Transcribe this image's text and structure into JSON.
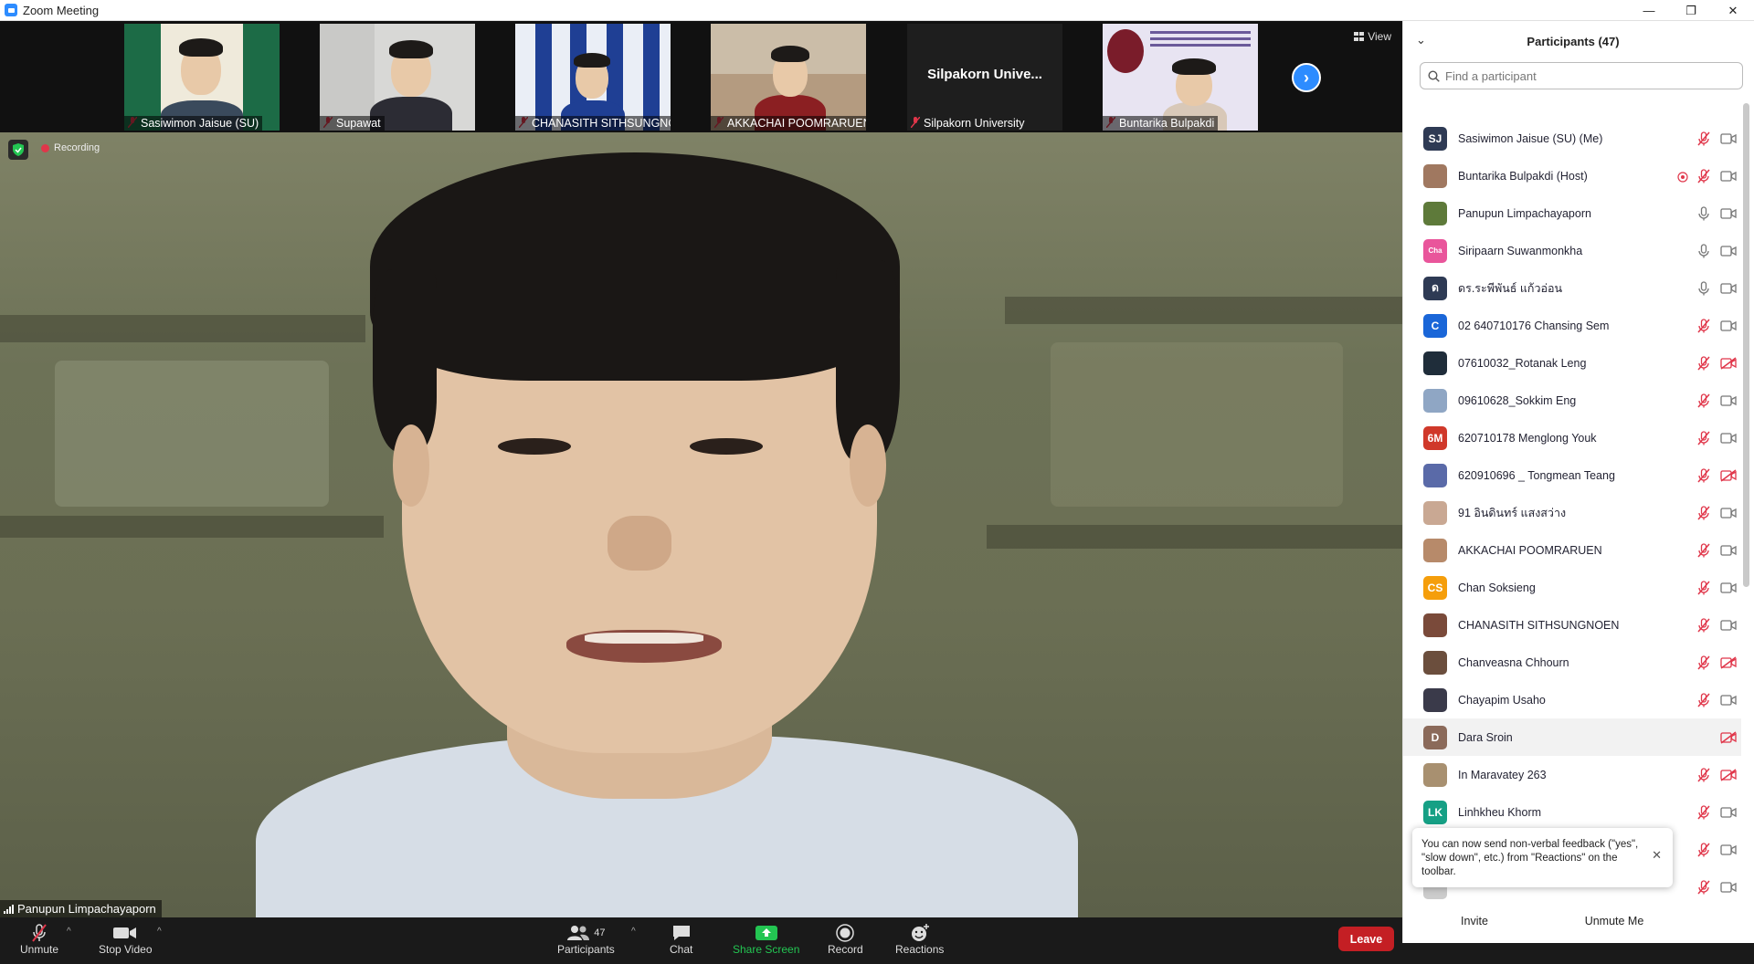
{
  "window": {
    "title": "Zoom Meeting",
    "controls": [
      "—",
      "❐",
      "✕"
    ]
  },
  "thumbnails": [
    {
      "name": "Sasiwimon Jaisue (SU)",
      "muted": true
    },
    {
      "name": "Supawat",
      "muted": true
    },
    {
      "name": "CHANASITH SITHSUNGNOEN",
      "muted": true
    },
    {
      "name": "AKKACHAI POOMRARUEN",
      "muted": true
    },
    {
      "name": "Silpakorn University",
      "muted": true,
      "display_text": "Silpakorn  Unive..."
    },
    {
      "name": "Buntarika Bulpakdi",
      "muted": true
    }
  ],
  "view_button": "View",
  "main": {
    "recording_label": "Recording",
    "speaker_name": "Panupun Limpachayaporn"
  },
  "toolbar": {
    "unmute": "Unmute",
    "stop_video": "Stop Video",
    "participants": "Participants",
    "participants_count": "47",
    "chat": "Chat",
    "share_screen": "Share Screen",
    "record": "Record",
    "reactions": "Reactions",
    "leave": "Leave"
  },
  "panel": {
    "title": "Participants (47)",
    "search_placeholder": "Find a participant",
    "participants": [
      {
        "name": "Sasiwimon Jaisue (SU) (Me)",
        "avatar": "SJ",
        "color": "#2e3a54",
        "mic": "off",
        "cam": "on"
      },
      {
        "name": "Buntarika Bulpakdi (Host)",
        "avatar": "",
        "color": "#a07860",
        "mic": "off",
        "cam": "on",
        "host_icon": true
      },
      {
        "name": "Panupun Limpachayaporn",
        "avatar": "",
        "color": "#5e7a3a",
        "mic": "on",
        "cam": "on"
      },
      {
        "name": "Siripaarn Suwanmonkha",
        "avatar": "Cha",
        "color": "#e9559b",
        "mic": "on",
        "cam": "on"
      },
      {
        "name": "ดร.ระพีพันธ์  แก้วอ่อน",
        "avatar": "ด",
        "color": "#2e3a54",
        "mic": "on",
        "cam": "on"
      },
      {
        "name": "02 640710176 Chansing Sem",
        "avatar": "C",
        "color": "#1a66d8",
        "mic": "off",
        "cam": "on"
      },
      {
        "name": "07610032_Rotanak Leng",
        "avatar": "",
        "color": "#1f2d3a",
        "mic": "off",
        "cam": "off"
      },
      {
        "name": "09610628_Sokkim Eng",
        "avatar": "",
        "color": "#8fa6c4",
        "mic": "off",
        "cam": "on"
      },
      {
        "name": "620710178 Menglong Youk",
        "avatar": "6M",
        "color": "#d0382a",
        "mic": "off",
        "cam": "on"
      },
      {
        "name": "620910696 _ Tongmean Teang",
        "avatar": "",
        "color": "#5a6aa8",
        "mic": "off",
        "cam": "off"
      },
      {
        "name": "91 อินดินทร์ แสงสว่าง",
        "avatar": "",
        "color": "#c9a893",
        "mic": "off",
        "cam": "on"
      },
      {
        "name": "AKKACHAI POOMRARUEN",
        "avatar": "",
        "color": "#b78a6a",
        "mic": "off",
        "cam": "on"
      },
      {
        "name": "Chan Soksieng",
        "avatar": "CS",
        "color": "#f59e0b",
        "mic": "off",
        "cam": "on"
      },
      {
        "name": "CHANASITH SITHSUNGNOEN",
        "avatar": "",
        "color": "#7a4a3a",
        "mic": "off",
        "cam": "on"
      },
      {
        "name": "Chanveasna Chhourn",
        "avatar": "",
        "color": "#6b4e3d",
        "mic": "off",
        "cam": "off"
      },
      {
        "name": "Chayapim Usaho",
        "avatar": "",
        "color": "#3a3a4a",
        "mic": "off",
        "cam": "on"
      },
      {
        "name": "Dara Sroin",
        "avatar": "D",
        "color": "#8b6a5a",
        "mic": "none",
        "cam": "off",
        "highlight": true
      },
      {
        "name": "In Maravatey 263",
        "avatar": "",
        "color": "#a89070",
        "mic": "off",
        "cam": "off"
      },
      {
        "name": "Linhkheu Khorm",
        "avatar": "LK",
        "color": "#16a085",
        "mic": "off",
        "cam": "on"
      },
      {
        "name": "",
        "avatar": "",
        "color": "#16a085",
        "mic": "off",
        "cam": "on"
      },
      {
        "name": "",
        "avatar": "",
        "color": "#cccccc",
        "mic": "off",
        "cam": "on"
      }
    ],
    "toast": "You can now send non-verbal feedback (\"yes\", \"slow down\", etc.) from \"Reactions\" on the toolbar.",
    "invite": "Invite",
    "unmute_me": "Unmute Me"
  }
}
